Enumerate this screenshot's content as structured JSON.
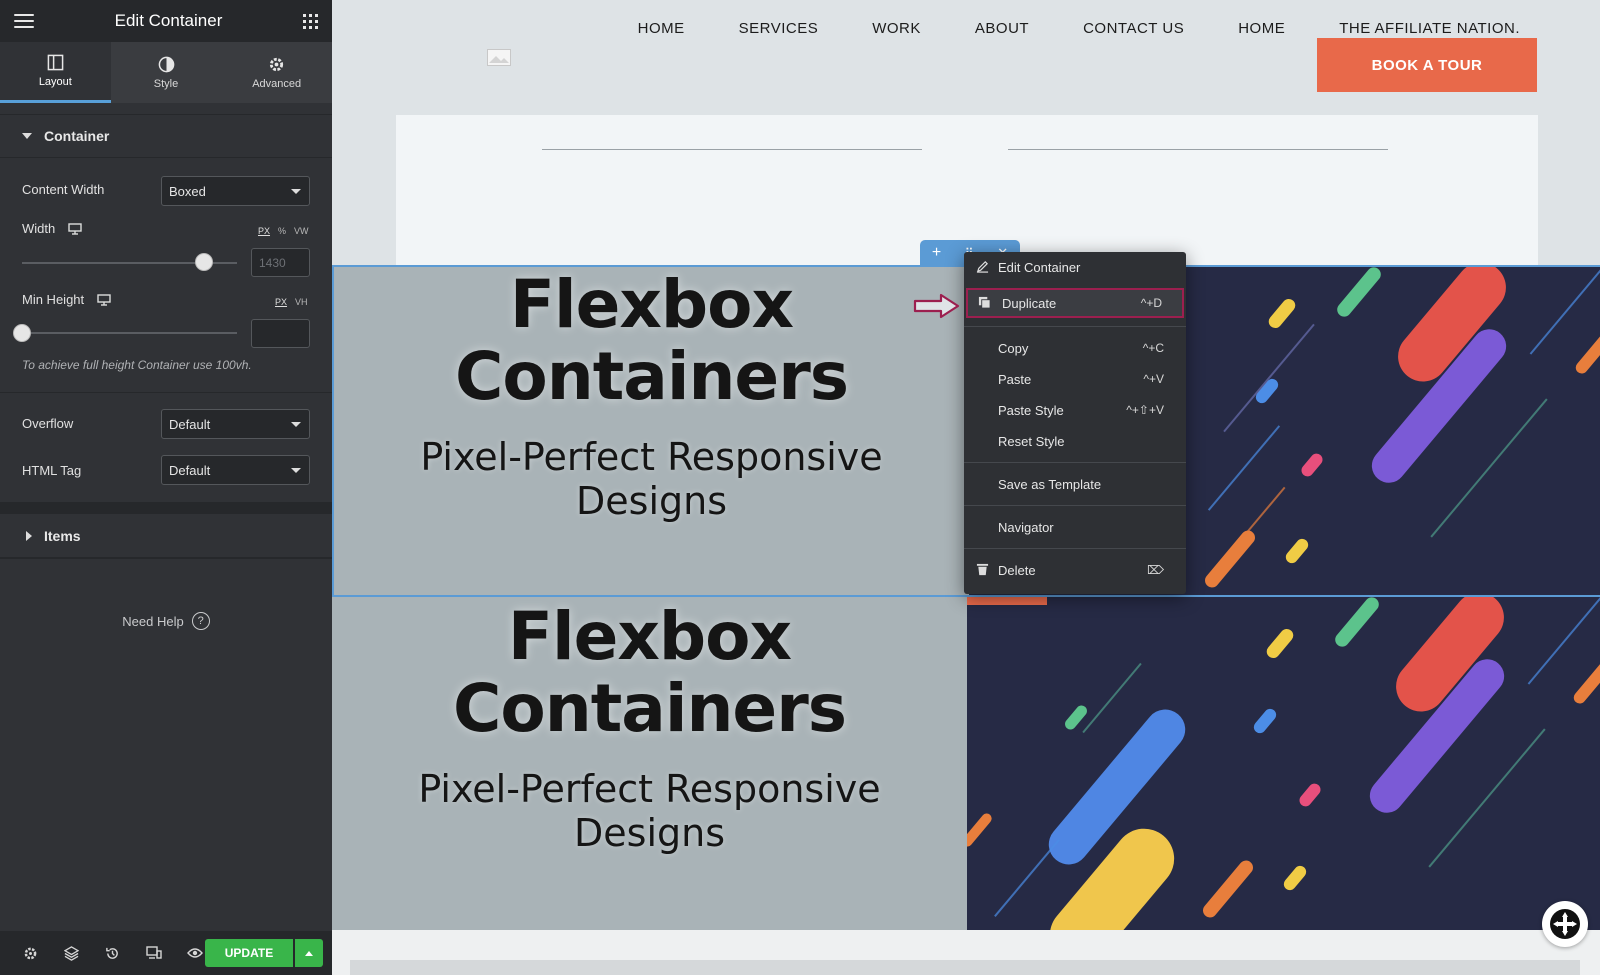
{
  "sidebar": {
    "title": "Edit Container",
    "tabs": [
      {
        "label": "Layout",
        "icon": "layout-icon",
        "active": true
      },
      {
        "label": "Style",
        "icon": "contrast-icon",
        "active": false
      },
      {
        "label": "Advanced",
        "icon": "gear-icon",
        "active": false
      }
    ],
    "sections": {
      "container": "Container",
      "items": "Items"
    },
    "fields": {
      "content_width_label": "Content Width",
      "content_width_value": "Boxed",
      "width_label": "Width",
      "width_units": [
        "PX",
        "%",
        "VW"
      ],
      "width_placeholder": "1430",
      "min_height_label": "Min Height",
      "min_height_units": [
        "PX",
        "VH"
      ],
      "min_height_hint": "To achieve full height Container use 100vh.",
      "overflow_label": "Overflow",
      "overflow_value": "Default",
      "html_tag_label": "HTML Tag",
      "html_tag_value": "Default"
    },
    "need_help": "Need Help",
    "need_help_icon": "?",
    "update_label": "UPDATE"
  },
  "canvas": {
    "nav": [
      "HOME",
      "SERVICES",
      "WORK",
      "ABOUT",
      "CONTACT US",
      "HOME",
      "THE AFFILIATE NATION."
    ],
    "book_button": "BOOK A TOUR",
    "heading_line1": "Flexbox",
    "heading_line2": "Containers",
    "subheading_line1": "Pixel-Perfect Responsive",
    "subheading_line2": "Designs"
  },
  "context_menu": {
    "items": [
      {
        "label": "Edit Container",
        "shortcut": "",
        "icon": "pencil-icon"
      },
      {
        "label": "Duplicate",
        "shortcut": "^+D",
        "icon": "duplicate-icon"
      },
      {
        "label": "Copy",
        "shortcut": "^+C"
      },
      {
        "label": "Paste",
        "shortcut": "^+V"
      },
      {
        "label": "Paste Style",
        "shortcut": "^+⇧+V"
      },
      {
        "label": "Reset Style",
        "shortcut": ""
      },
      {
        "label": "Save as Template",
        "shortcut": ""
      },
      {
        "label": "Navigator",
        "shortcut": ""
      },
      {
        "label": "Delete",
        "shortcut": "⌦",
        "icon": "trash-icon"
      }
    ]
  },
  "colors": {
    "accent_blue": "#5b9bd5",
    "update_green": "#39b54a",
    "book_orange": "#e8694a",
    "highlight": "#9c1f4f"
  }
}
